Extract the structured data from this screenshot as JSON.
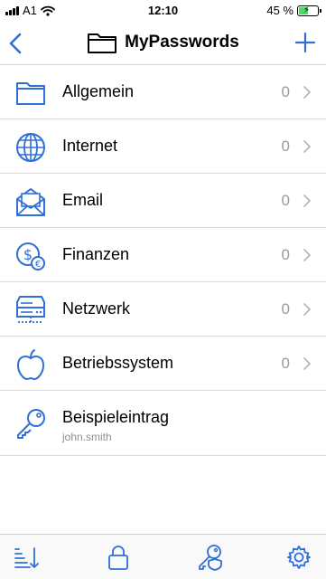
{
  "status_bar": {
    "carrier": "A1",
    "time": "12:10",
    "battery_percent": "45 %",
    "battery_level": 0.45,
    "icons": [
      "signal-icon",
      "wifi-icon",
      "battery-charging-icon"
    ]
  },
  "nav": {
    "title": "MyPasswords",
    "back_icon": "chevron-left-icon",
    "title_icon": "folder-icon",
    "add_icon": "plus-icon"
  },
  "groups": [
    {
      "label": "Allgemein",
      "count": "0",
      "icon": "folder-icon"
    },
    {
      "label": "Internet",
      "count": "0",
      "icon": "globe-icon"
    },
    {
      "label": "Email",
      "count": "0",
      "icon": "envelope-icon"
    },
    {
      "label": "Finanzen",
      "count": "0",
      "icon": "money-icon"
    },
    {
      "label": "Netzwerk",
      "count": "0",
      "icon": "server-icon"
    },
    {
      "label": "Betriebssystem",
      "count": "0",
      "icon": "apple-icon"
    }
  ],
  "entries": [
    {
      "title": "Beispieleintrag",
      "username": "john.smith",
      "icon": "key-icon"
    }
  ],
  "tab_bar": {
    "icons": [
      "sort-icon",
      "lock-icon",
      "key-shield-icon",
      "gear-icon"
    ]
  },
  "colors": {
    "accent": "#2f6fd6",
    "battery_fill": "#4cd964",
    "count_text": "#9a9a9a",
    "divider": "#d9d9d9"
  }
}
